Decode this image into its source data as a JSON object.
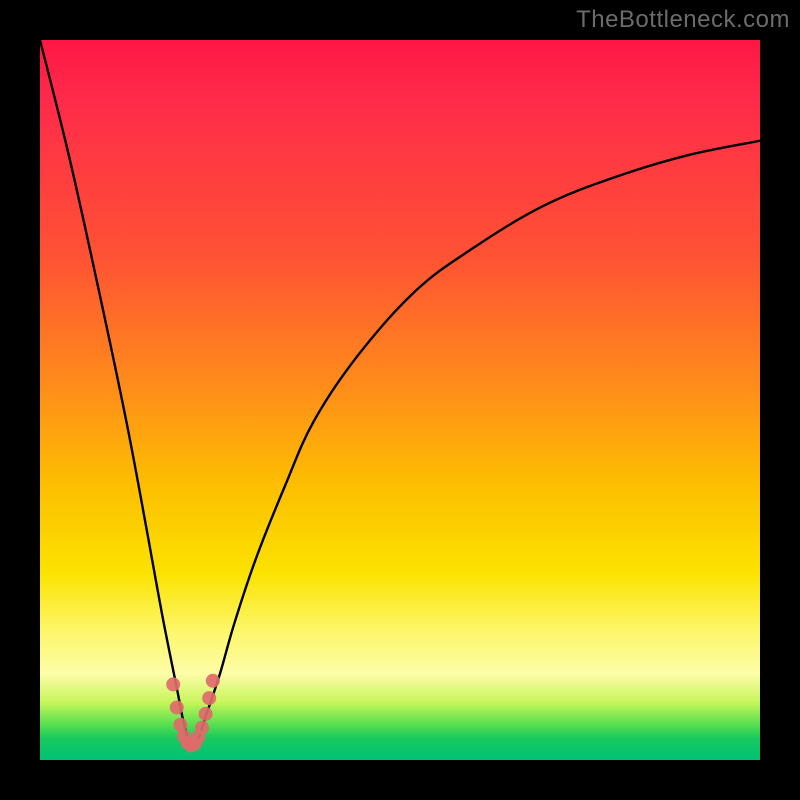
{
  "attribution": "TheBottleneck.com",
  "colors": {
    "frame_bg": "#000000",
    "gradient_top": "#ff1744",
    "gradient_mid_upper": "#ff8c1a",
    "gradient_mid": "#fbe200",
    "gradient_mid_lower": "#fdfda8",
    "gradient_bottom": "#00c275",
    "curve": "#000000",
    "marker": "#e06a6a"
  },
  "chart_data": {
    "type": "line",
    "title": "",
    "xlabel": "",
    "ylabel": "",
    "xlim": [
      0,
      100
    ],
    "ylim": [
      0,
      100
    ],
    "grid": false,
    "legend_position": "none",
    "series": [
      {
        "name": "bottleneck-curve",
        "comment": "Single V-shaped curve. y is bottleneck percentage (0 = bottom/green/no bottleneck, 100 = top/red/full bottleneck). Minimum near x≈21.",
        "x": [
          0,
          4,
          8,
          12,
          15,
          17,
          19,
          20,
          21,
          22,
          23,
          25,
          27,
          30,
          34,
          38,
          44,
          52,
          60,
          70,
          80,
          90,
          100
        ],
        "values": [
          100,
          84,
          66,
          47,
          31,
          20,
          10,
          5,
          2,
          3,
          6,
          12,
          19,
          28,
          38,
          47,
          56,
          65,
          71,
          77,
          81,
          84,
          86
        ]
      },
      {
        "name": "sweet-spot-markers",
        "comment": "Pink dots clustered around the curve's minimum (the 'sweet spot').",
        "x": [
          18.5,
          19.0,
          19.5,
          20.0,
          20.5,
          21.0,
          21.5,
          22.0,
          22.5,
          23.0,
          23.5,
          24.0
        ],
        "values": [
          10.5,
          7.3,
          4.9,
          3.3,
          2.4,
          2.0,
          2.3,
          3.2,
          4.5,
          6.4,
          8.6,
          11.0
        ]
      }
    ]
  }
}
